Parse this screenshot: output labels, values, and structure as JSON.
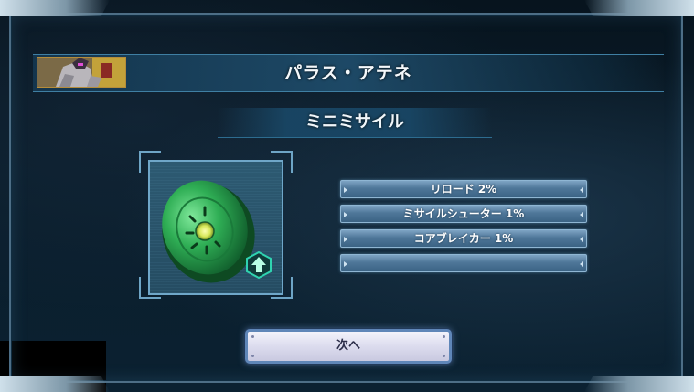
{
  "dialog": {
    "character_name": "パラス・アテネ",
    "item_name": "ミニミサイル"
  },
  "skills": [
    {
      "label": "リロード 2%"
    },
    {
      "label": "ミサイルシューター 1%"
    },
    {
      "label": "コアブレイカー 1%"
    },
    {
      "label": ""
    }
  ],
  "buttons": {
    "next_label": "次へ"
  },
  "icons": {
    "item": "green-disc-part-icon",
    "upgrade": "upgrade-arrow-icon",
    "portrait": "character-portrait"
  },
  "colors": {
    "accent": "#3f7fa3",
    "skill_bar": "#4f7799",
    "button_face": "#dcdcee",
    "item_green": "#2fae55",
    "upgrade_teal": "#2fd3b0"
  }
}
